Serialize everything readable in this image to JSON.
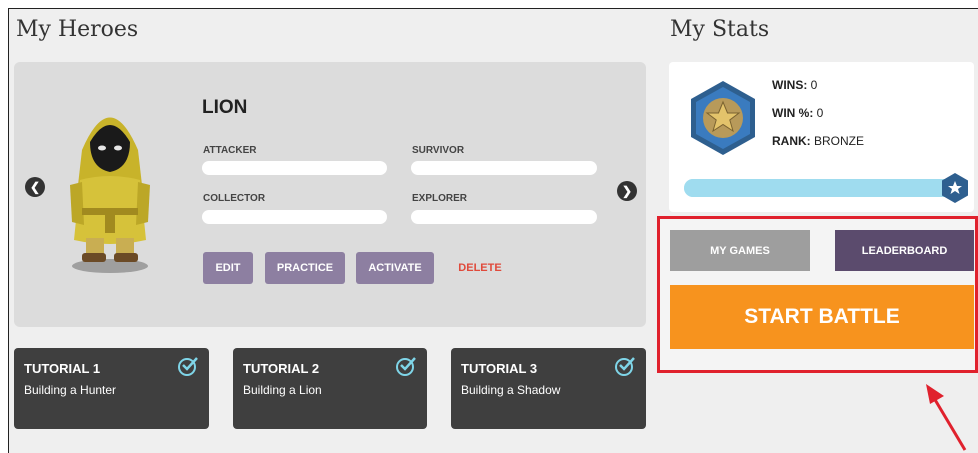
{
  "heroes": {
    "title": "My Heroes",
    "hero_name": "LION",
    "attributes": [
      {
        "label": "ATTACKER",
        "value": 0
      },
      {
        "label": "SURVIVOR",
        "value": 0
      },
      {
        "label": "COLLECTOR",
        "value": 0
      },
      {
        "label": "EXPLORER",
        "value": 0
      }
    ],
    "actions": {
      "edit": "EDIT",
      "practice": "PRACTICE",
      "activate": "ACTIVATE",
      "delete": "DELETE"
    },
    "prev_icon": "chevron-left-icon",
    "next_icon": "chevron-right-icon",
    "avatar_icon": "hooded-hero-icon"
  },
  "tutorials": [
    {
      "title": "TUTORIAL 1",
      "subtitle": "Building a Hunter",
      "completed": true
    },
    {
      "title": "TUTORIAL 2",
      "subtitle": "Building a Lion",
      "completed": true
    },
    {
      "title": "TUTORIAL 3",
      "subtitle": "Building a Shadow",
      "completed": true
    }
  ],
  "stats": {
    "title": "My Stats",
    "wins_label": "WINS:",
    "wins_value": "0",
    "winpct_label": "WIN %:",
    "winpct_value": "0",
    "rank_label": "RANK:",
    "rank_value": "BRONZE",
    "rank_progress": 1.0,
    "rank_icon": "star-badge-icon"
  },
  "battle": {
    "my_games": "MY GAMES",
    "leaderboard": "LEADERBOARD",
    "start_battle": "START BATTLE"
  },
  "colors": {
    "accent_orange": "#f7931e",
    "purple": "#8d7fa1",
    "dark_purple": "#5b4b6d",
    "highlight_red": "#e0212d"
  }
}
